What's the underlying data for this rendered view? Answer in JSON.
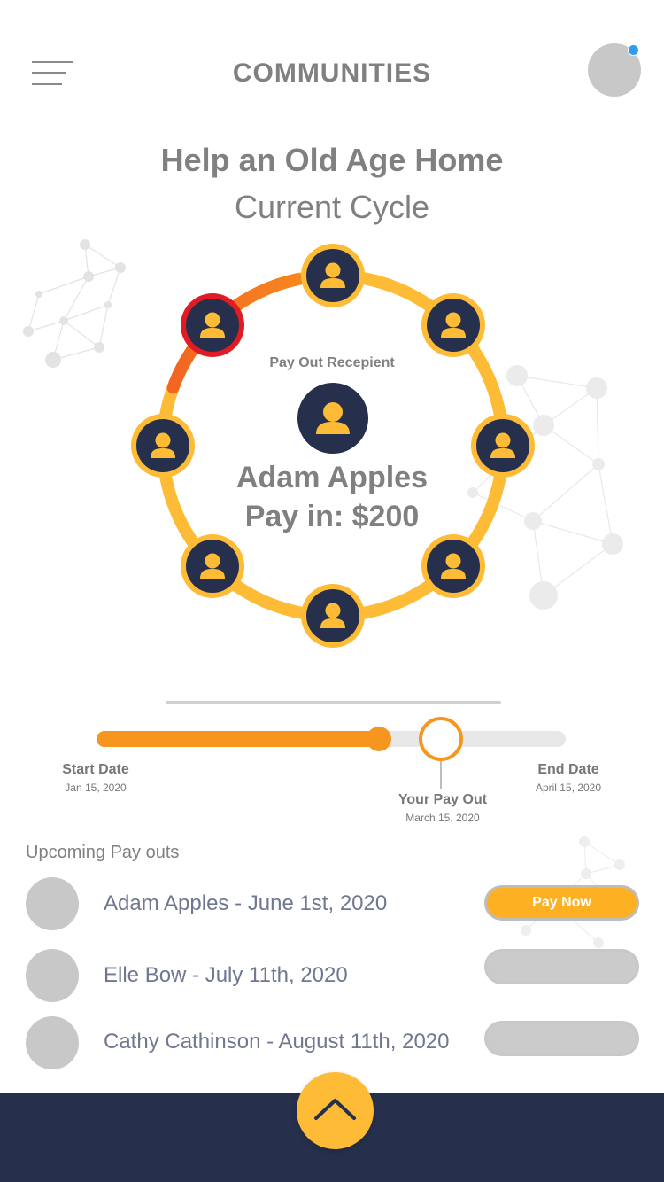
{
  "header": {
    "title": "COMMUNITIES",
    "menu_icon": "hamburger-icon",
    "notification_color": "#2d9cf5"
  },
  "page": {
    "title": "Help an Old Age Home",
    "subtitle": "Current Cycle"
  },
  "cycle": {
    "recipient_label": "Pay Out Recepient",
    "recipient_name": "Adam Apples",
    "pay_in": "Pay in: $200",
    "member_icon": "person-icon",
    "member_count": 8,
    "active_member_index": 7,
    "colors": {
      "ring": "#fdbb36",
      "active": "#e01b24",
      "member_bg": "#26304d"
    }
  },
  "timeline": {
    "progress": 0.61,
    "payout_position": 0.74,
    "start": {
      "label": "Start Date",
      "date": "Jan 15, 2020"
    },
    "end": {
      "label": "End Date",
      "date": "April 15, 2020"
    },
    "payout": {
      "label": "Your Pay Out",
      "date": "March 15, 2020"
    },
    "accent": "#f7961f"
  },
  "upcoming": {
    "title": "Upcoming Pay outs",
    "items": [
      {
        "text": "Adam Apples - June 1st, 2020",
        "button": "Pay Now"
      },
      {
        "text": "Elle Bow - July 11th, 2020",
        "button": ""
      },
      {
        "text": "Cathy Cathinson - August 11th, 2020",
        "button": ""
      }
    ]
  },
  "footer": {
    "fab_icon": "chevron-up-icon",
    "background": "#26304d"
  }
}
